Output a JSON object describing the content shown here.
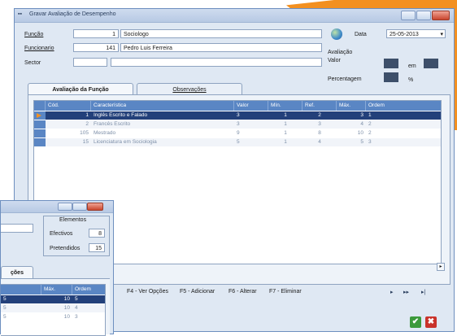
{
  "window": {
    "title": "Gravar Avaliação de Desempenho"
  },
  "form": {
    "funcao_label": "Função",
    "funcao_code": "1",
    "funcao_name": "Sociologo",
    "funcionario_label": "Funcionario",
    "funcionario_code": "141",
    "funcionario_name": "Pedro Luis Ferreira",
    "sector_label": "Sector",
    "sector_value": "",
    "data_label": "Data",
    "data_value": "25-05-2013",
    "avaliacao_label": "Avaliação",
    "valor_label": "Valor",
    "em_label": "em",
    "percentagem_label": "Percentagem",
    "pct_sign": "%"
  },
  "tabs": [
    {
      "label": "Avaliação da Função"
    },
    {
      "label": "Observações"
    }
  ],
  "grid": {
    "headers": [
      "Cód.",
      "Característica",
      "Valor",
      "Mín.",
      "Ref.",
      "Máx.",
      "Ordem"
    ],
    "rows": [
      {
        "cod": "1",
        "car": "Inglês Escrito e Falado",
        "valor": "3",
        "min": "1",
        "ref": "2",
        "max": "3",
        "ord": "1",
        "selected": true
      },
      {
        "cod": "2",
        "car": "Francês Escrito",
        "valor": "3",
        "min": "1",
        "ref": "3",
        "max": "4",
        "ord": "2",
        "selected": false
      },
      {
        "cod": "105",
        "car": "Mestrado",
        "valor": "9",
        "min": "1",
        "ref": "8",
        "max": "10",
        "ord": "2",
        "selected": false
      },
      {
        "cod": "15",
        "car": "Licenciatura em Sociologia",
        "valor": "5",
        "min": "1",
        "ref": "4",
        "max": "5",
        "ord": "3",
        "selected": false
      }
    ]
  },
  "footer": {
    "f4": "F4 - Ver Opções",
    "f5": "F5 - Adicionar",
    "f6": "F6 - Alterar",
    "f7": "F7 - Eliminar",
    "nav_next": "▸",
    "nav_last": "▸▸",
    "nav_end": "▸|"
  },
  "back_window": {
    "elements_label": "Elementos",
    "efectivos_label": "Efectivos",
    "efectivos_value": "8",
    "pretendidos_label": "Pretendidos",
    "pretendidos_value": "15",
    "tab_label": "ções",
    "headers": [
      "Máx.",
      "Ordem"
    ],
    "rows": [
      {
        "a": "5",
        "max": "10",
        "ord": "5",
        "selected": true
      },
      {
        "a": "5",
        "max": "10",
        "ord": "4",
        "selected": false
      },
      {
        "a": "5",
        "max": "10",
        "ord": "3",
        "selected": false
      }
    ]
  },
  "colors": {
    "accent_orange": "#f39020",
    "header_blue": "#5a86c4",
    "selected_row": "#23407a",
    "ok_green": "#3c9a3c",
    "cancel_red": "#c9322a"
  },
  "icons": {
    "app": "app-icon",
    "globe": "globe-icon",
    "row_pointer": "row-pointer-icon",
    "ok": "checkmark-icon",
    "cancel": "close-icon"
  }
}
